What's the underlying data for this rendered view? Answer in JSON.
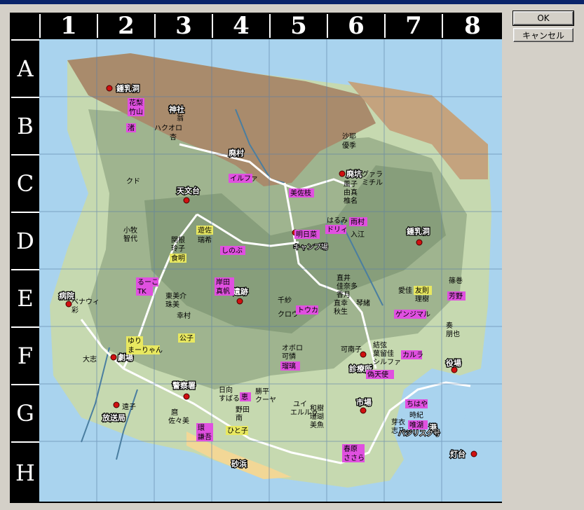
{
  "dialog": {
    "ok_label": "OK",
    "cancel_label": "キャンセル"
  },
  "grid": {
    "columns": [
      "1",
      "2",
      "3",
      "4",
      "5",
      "6",
      "7",
      "8"
    ],
    "rows": [
      "A",
      "B",
      "C",
      "D",
      "E",
      "F",
      "G",
      "H"
    ]
  },
  "map": {
    "places": {
      "shonyudo_north": "鍾乳洞",
      "shrine": "神社",
      "ruined_village": "廃村",
      "mine": "廃坑",
      "observatory": "天文台",
      "camp": "キャンプ場",
      "shonyudo_east": "鍾乳洞",
      "ruins": "遺跡",
      "hospital": "病院",
      "theater": "劇場",
      "police": "警察署",
      "clinic": "診療所",
      "office": "役場",
      "broadcast": "放送局",
      "market": "市場",
      "port": "港",
      "lighthouse": "灯台",
      "beach": "砂浜"
    },
    "names": {
      "hanari": "花梨",
      "takeyama": "竹山",
      "nagisa": "渚",
      "okina": "翁",
      "hakuoro": "ハクオロ",
      "kyo": "杏",
      "shaya": "沙耶",
      "yukiko": "優季",
      "ilfa": "イルファ",
      "misaki": "美佐枝",
      "gurea": "グァラ",
      "michiru": "ミチル",
      "fuko": "風子",
      "mayu": "由真",
      "shiina": "椎名",
      "kudo": "クド",
      "komaki": "小牧",
      "chiyo": "智代",
      "sekido": "関根",
      "reiko": "玲子",
      "kyomei": "食明",
      "yusa": "遊佐",
      "mizuki": "瑞希",
      "shinobu": "しのぶ",
      "asuna": "明日菜",
      "harumi": "はるみ",
      "doribu": "ドリィ",
      "amamura": "雨村",
      "ie": "入江",
      "ruko": "るーこ",
      "tk": "TK",
      "kishida": "岸田",
      "makoto": "真帆",
      "tomoe": "東美介",
      "shumi": "珠美",
      "chisa": "千紗",
      "kurou": "クロウ",
      "touka": "トウカ",
      "naoi": "直井",
      "kanae": "佳奈多",
      "kotomi": "香月",
      "arisa": "琴緒",
      "suisei": "直幸",
      "akie": "秋生",
      "aya": "愛佳",
      "yuri": "友則",
      "risa": "理樹",
      "sasakimaki": "篠巻",
      "yoshino": "芳野",
      "genjimaru": "ゲンジマル",
      "sena": "奏",
      "akuya": "朋也",
      "benaw": "ベナウィ",
      "aya2": "彩",
      "komura": "幸村",
      "kimiko": "公子",
      "yuri2": "ゆり",
      "mariyan": "まーりゃん",
      "taishi": "大志",
      "oboro": "オボロ",
      "kasumi": "可憐",
      "ruri": "瑠璃",
      "kanako": "可南子",
      "yuika": "結弦",
      "yukie": "葉留佳",
      "shirufa": "シルファ",
      "karura": "カルラ",
      "gitensen": "偽天使",
      "hinata": "日向",
      "subaru": "すばる",
      "megumi": "恵",
      "katsuhira": "勝平",
      "kuuya": "クーヤ",
      "noda": "野田",
      "minami": "南",
      "hakushi": "麿",
      "sasami": "佐々美",
      "yui": "ユイ",
      "eruru": "エルルゥ",
      "waju": "和樹",
      "sango": "珊瑚",
      "mioi": "美魚",
      "kyoto": "遠子",
      "tamaki": "環",
      "kenmei": "謙吾",
      "hitoko": "ひと子",
      "chihaya": "ちはや",
      "nobu": "時紀",
      "yuiko": "唯湖",
      "kanon": "芽衣",
      "shino": "志乃",
      "haruka": "春原",
      "sasara": "ささら",
      "basilisk": "バジリスク号"
    }
  }
}
